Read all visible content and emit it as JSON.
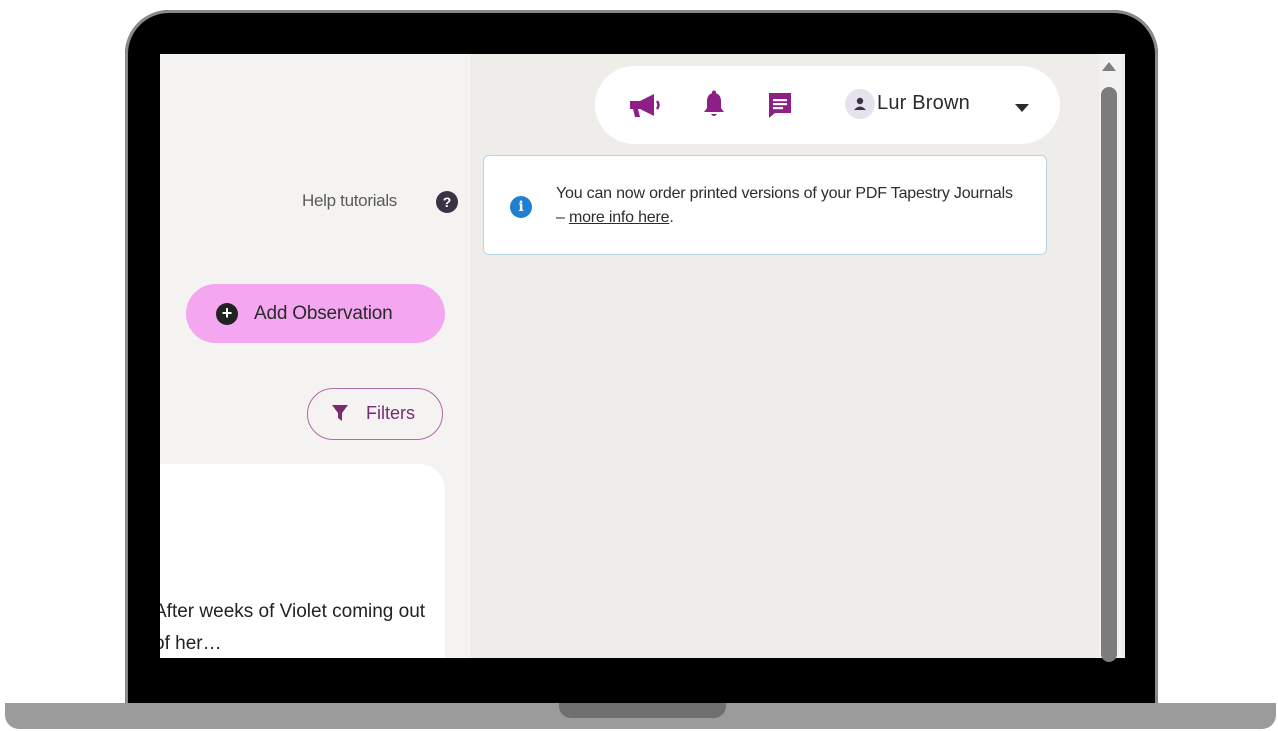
{
  "user_bar": {
    "icons": [
      "megaphone-icon",
      "bell-icon",
      "messages-icon"
    ],
    "user_name": "Lur Brown",
    "accent_color": "#8e1f86"
  },
  "help": {
    "label": "Help tutorials",
    "icon_glyph": "?"
  },
  "banner": {
    "icon_glyph": "i",
    "text_before": "You can now order printed versions of your PDF Tapestry Journals – ",
    "link_text": "more info here",
    "text_after": "."
  },
  "actions": {
    "add_observation_label": "Add Observation",
    "add_observation_glyph": "+",
    "filters_label": "Filters"
  },
  "card": {
    "preview_text": "After weeks of Violet coming out of her…"
  }
}
